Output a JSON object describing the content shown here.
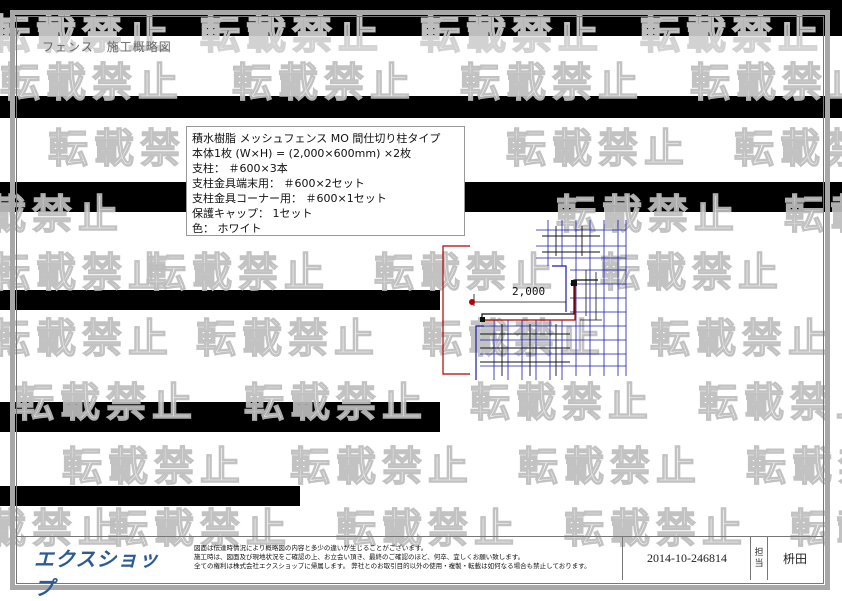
{
  "document": {
    "title": "フェンス　施工概略図"
  },
  "watermark": {
    "text": "転載禁止"
  },
  "spec": {
    "lines": [
      "積水樹脂 メッシュフェンス MO 間仕切り柱タイプ",
      "本体1枚 (W×H) = (2,000×600mm) ×2枚",
      "支柱： ＃600×3本",
      "支柱金具端末用： ＃600×2セット",
      "支柱金具コーナー用： ＃600×1セット",
      "保護キャップ： 1セット",
      "色： ホワイト"
    ]
  },
  "drawing": {
    "dimension_label": "2,000",
    "colors": {
      "fence": "#b00000",
      "grid": "#1a1aa8",
      "line": "#111111"
    }
  },
  "footer": {
    "brand": "エクスショップ",
    "notes": [
      "図面は伝達時情況により概略図の内容と多少の違いが生じることがございます。",
      "施工時は、図面及び現地状況をご確認の上、お立会い頂き、最終のご確認のほど、何卒、宜しくお願い致します。",
      "全ての権利は株式会社エクスショップに帰属します。 弊社とのお取引目的以外の使用・複製・転載は如何なる場合も禁止しております。"
    ],
    "doc_number": "2014-10-246814",
    "staff_label": "担当",
    "staff_name": "枡田"
  },
  "brand_color": "#2c5a93"
}
